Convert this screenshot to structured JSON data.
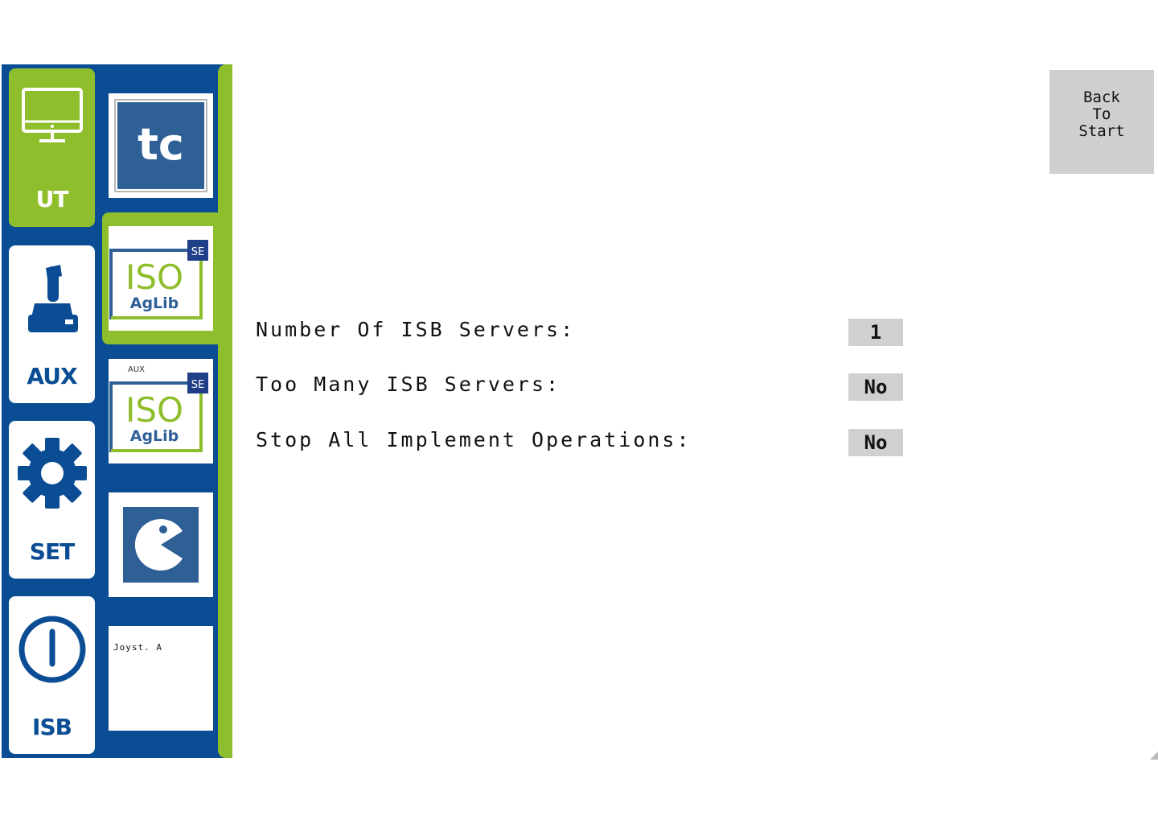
{
  "nav": {
    "items": [
      {
        "label": "UT",
        "icon": "monitor-icon",
        "active": true
      },
      {
        "label": "AUX",
        "icon": "joystick-icon",
        "active": false
      },
      {
        "label": "SET",
        "icon": "gear-icon",
        "active": false
      },
      {
        "label": "ISB",
        "icon": "power-icon",
        "active": false
      }
    ]
  },
  "apps": {
    "items": [
      {
        "name": "tc",
        "icon": "tc-icon"
      },
      {
        "name": "ISO AgLib",
        "badge": "SE",
        "icon": "isoaglib-logo-icon",
        "selected": true
      },
      {
        "name": "ISO AgLib",
        "top_label": "AUX",
        "badge": "SE",
        "icon": "isoaglib-aux-logo-icon"
      },
      {
        "name": "pacman",
        "icon": "pacman-icon"
      },
      {
        "name": "Joyst. A",
        "icon": ""
      }
    ]
  },
  "main": {
    "rows": [
      {
        "label": "Number Of ISB Servers:",
        "value": "1"
      },
      {
        "label": "Too Many ISB Servers:",
        "value": "No"
      },
      {
        "label": "Stop All Implement Operations:",
        "value": "No"
      }
    ]
  },
  "back_button": {
    "line1": "Back",
    "line2": "To",
    "line3": "Start"
  },
  "colors": {
    "navy": "#0a4d94",
    "green": "#8fbe2c",
    "tile_blue": "#2e6096",
    "value_bg": "#d0d0d0",
    "button_bg": "#cfcfcf"
  }
}
